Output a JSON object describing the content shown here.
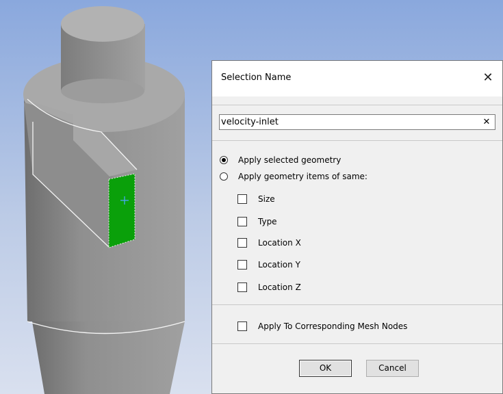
{
  "dialog": {
    "title": "Selection Name",
    "name_value": "velocity-inlet",
    "radio_options": [
      {
        "label": "Apply selected geometry",
        "selected": true
      },
      {
        "label": "Apply geometry items of same:",
        "selected": false
      }
    ],
    "criteria": [
      {
        "label": "Size",
        "checked": false
      },
      {
        "label": "Type",
        "checked": false
      },
      {
        "label": "Location X",
        "checked": false
      },
      {
        "label": "Location Y",
        "checked": false
      },
      {
        "label": "Location Z",
        "checked": false
      }
    ],
    "mesh_nodes_label": "Apply To Corresponding Mesh Nodes",
    "ok_label": "OK",
    "cancel_label": "Cancel"
  },
  "viewport": {
    "background_top": "#8aa8dd",
    "body_color": "#9a9a9a",
    "selected_face_color": "#0aa00a"
  }
}
